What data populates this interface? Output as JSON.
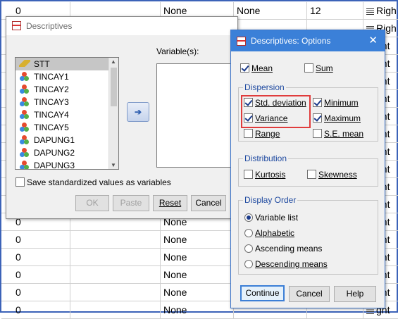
{
  "grid": {
    "rows": [
      {
        "c1": "0",
        "c2": "",
        "c3": "None",
        "c4": "None",
        "c5": "12",
        "c6": "Righ"
      },
      {
        "c1": "",
        "c2": "",
        "c3": "",
        "c4": "",
        "c5": "",
        "c6": "Righ"
      },
      {
        "c1": "",
        "c2": "",
        "c3": "",
        "c4": "",
        "c5": "",
        "c6": "ght"
      },
      {
        "c1": "",
        "c2": "",
        "c3": "",
        "c4": "",
        "c5": "",
        "c6": "ght"
      },
      {
        "c1": "",
        "c2": "",
        "c3": "",
        "c4": "",
        "c5": "",
        "c6": "ght"
      },
      {
        "c1": "",
        "c2": "",
        "c3": "",
        "c4": "",
        "c5": "",
        "c6": "ght"
      },
      {
        "c1": "",
        "c2": "",
        "c3": "",
        "c4": "",
        "c5": "",
        "c6": "ght"
      },
      {
        "c1": "",
        "c2": "",
        "c3": "",
        "c4": "",
        "c5": "",
        "c6": "ght"
      },
      {
        "c1": "",
        "c2": "",
        "c3": "",
        "c4": "",
        "c5": "",
        "c6": "ght"
      },
      {
        "c1": "",
        "c2": "",
        "c3": "",
        "c4": "",
        "c5": "",
        "c6": "ght"
      },
      {
        "c1": "",
        "c2": "",
        "c3": "",
        "c4": "",
        "c5": "",
        "c6": "ght"
      },
      {
        "c1": "",
        "c2": "",
        "c3": "",
        "c4": "",
        "c5": "",
        "c6": "ght"
      },
      {
        "c1": "0",
        "c2": "",
        "c3": "None",
        "c4": "",
        "c5": "",
        "c6": "ght"
      },
      {
        "c1": "0",
        "c2": "",
        "c3": "None",
        "c4": "",
        "c5": "",
        "c6": "ght"
      },
      {
        "c1": "0",
        "c2": "",
        "c3": "None",
        "c4": "",
        "c5": "",
        "c6": "ght"
      },
      {
        "c1": "0",
        "c2": "",
        "c3": "None",
        "c4": "",
        "c5": "",
        "c6": "ght"
      },
      {
        "c1": "0",
        "c2": "",
        "c3": "None",
        "c4": "",
        "c5": "",
        "c6": "ght"
      },
      {
        "c1": "0",
        "c2": "",
        "c3": "None",
        "c4": "",
        "c5": "",
        "c6": "ght"
      }
    ]
  },
  "descriptives": {
    "title": "Descriptives",
    "variables": [
      "STT",
      "TINCAY1",
      "TINCAY2",
      "TINCAY3",
      "TINCAY4",
      "TINCAY5",
      "DAPUNG1",
      "DAPUNG2",
      "DAPUNG3"
    ],
    "variables_label": "Variable(s):",
    "save_std": "Save standardized values as variables",
    "buttons": {
      "ok": "OK",
      "paste": "Paste",
      "reset": "Reset",
      "cancel": "Cancel"
    }
  },
  "options": {
    "title": "Descriptives: Options",
    "close": "✕",
    "mean": "Mean",
    "sum": "Sum",
    "dispersion": {
      "group": "Dispersion",
      "std": "Std. deviation",
      "minimum": "Minimum",
      "variance": "Variance",
      "maximum": "Maximum",
      "range": "Range",
      "se_mean": "S.E. mean"
    },
    "distribution": {
      "group": "Distribution",
      "kurtosis": "Kurtosis",
      "skewness": "Skewness"
    },
    "display_order": {
      "group": "Display Order",
      "variable_list": "Variable list",
      "alphabetic": "Alphabetic",
      "ascending": "Ascending means",
      "descending": "Descending means"
    },
    "buttons": {
      "continue": "Continue",
      "cancel": "Cancel",
      "help": "Help"
    }
  },
  "colors": {
    "titlebar_active": "#3b80d8",
    "highlight_box": "#e03c3c",
    "group_title": "#1f4aa0"
  }
}
